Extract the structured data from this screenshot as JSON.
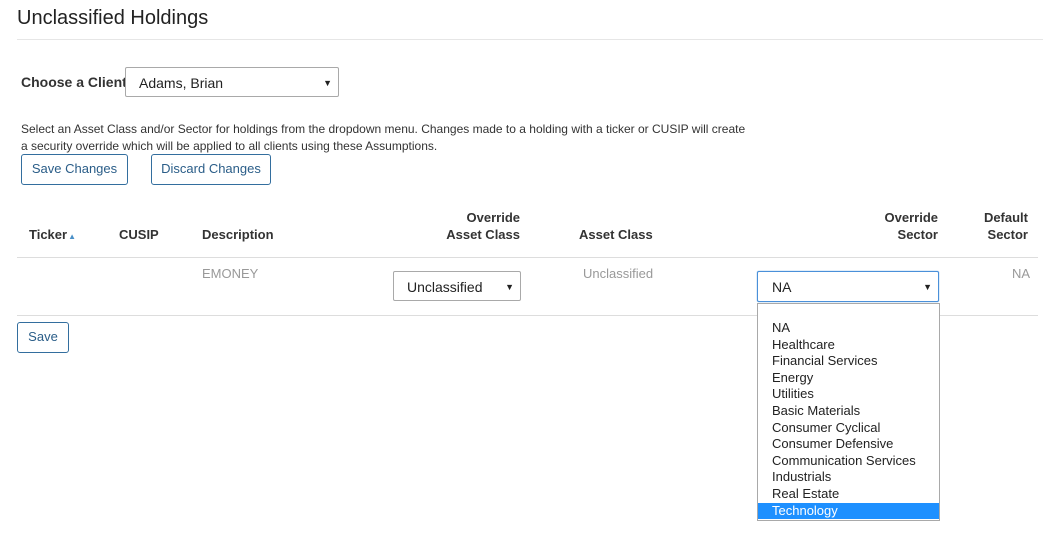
{
  "page": {
    "title": "Unclassified Holdings"
  },
  "client": {
    "label": "Choose a Client:",
    "selected": "Adams, Brian"
  },
  "instructions": {
    "line1": "Select an Asset Class and/or Sector for holdings from the dropdown menu. Changes made to a holding with a ticker or CUSIP will create",
    "line2": "a security override which will be applied to all clients using these Assumptions."
  },
  "actions": {
    "save_changes": "Save Changes",
    "discard_changes": "Discard Changes",
    "save": "Save"
  },
  "table": {
    "headers": {
      "ticker": "Ticker",
      "cusip": "CUSIP",
      "description": "Description",
      "override_asset_class_1": "Override",
      "override_asset_class_2": "Asset Class",
      "asset_class": "Asset Class",
      "override_sector_1": "Override",
      "override_sector_2": "Sector",
      "default_sector_1": "Default",
      "default_sector_2": "Sector"
    },
    "rows": [
      {
        "ticker": "",
        "cusip": "",
        "description": "EMONEY",
        "override_asset_class": "Unclassified",
        "asset_class": "Unclassified",
        "override_sector": "NA",
        "default_sector": "NA"
      }
    ]
  },
  "sector_dropdown": {
    "options": [
      "NA",
      "Healthcare",
      "Financial Services",
      "Energy",
      "Utilities",
      "Basic Materials",
      "Consumer Cyclical",
      "Consumer Defensive",
      "Communication Services",
      "Industrials",
      "Real Estate",
      "Technology"
    ],
    "highlighted": "Technology"
  },
  "colors": {
    "button_border": "#336e9e",
    "button_text": "#2a5d88",
    "highlight": "#1e90ff",
    "muted_text": "#999999"
  },
  "icons": {
    "sort": "sort-ascending-icon",
    "caret": "chevron-down-icon"
  }
}
